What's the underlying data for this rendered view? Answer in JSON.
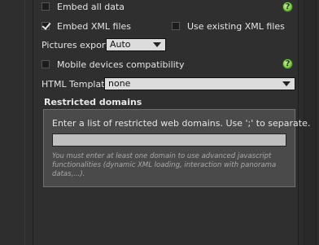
{
  "options": {
    "embed_all_data": {
      "label": "Embed all data",
      "checked": false
    },
    "embed_xml_files": {
      "label": "Embed XML files",
      "checked": true
    },
    "use_existing_xml": {
      "label": "Use existing XML files",
      "checked": false
    },
    "pictures_export": {
      "label": "Pictures export",
      "value": "Auto"
    },
    "mobile_compat": {
      "label": "Mobile devices compatibility",
      "checked": false
    },
    "html_template": {
      "label": "HTML Template",
      "value": "none"
    }
  },
  "help_icon": {
    "glyph": "?",
    "color": "#7fc64a"
  },
  "restricted": {
    "title": "Restricted domains",
    "hint": "Enter a list of restricted web domains. Use ';' to separate.",
    "value": "",
    "warning": "You must enter at least one domain to use advanced javascript functionalities (dynamic XML loading, interaction with panorama datas,...)."
  }
}
